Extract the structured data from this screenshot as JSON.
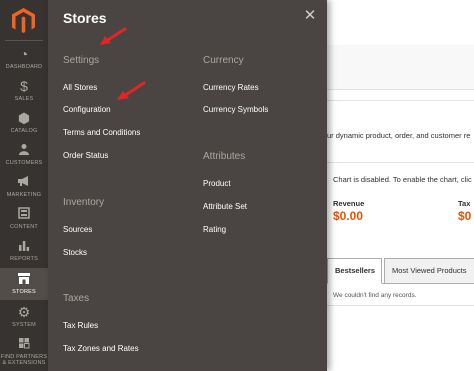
{
  "nav": {
    "items": [
      {
        "label": "DASHBOARD",
        "icon": "dashboard-icon",
        "glyph": "◔"
      },
      {
        "label": "SALES",
        "icon": "dollar-icon",
        "glyph": "$"
      },
      {
        "label": "CATALOG",
        "icon": "cube-icon",
        "glyph": "⬢"
      },
      {
        "label": "CUSTOMERS",
        "icon": "customers-icon",
        "glyph": "👤"
      },
      {
        "label": "MARKETING",
        "icon": "megaphone-icon",
        "glyph": "📢"
      },
      {
        "label": "CONTENT",
        "icon": "content-icon",
        "glyph": "▦"
      },
      {
        "label": "REPORTS",
        "icon": "reports-icon",
        "glyph": "▮"
      },
      {
        "label": "STORES",
        "icon": "store-icon",
        "glyph": "⌂"
      },
      {
        "label": "SYSTEM",
        "icon": "gear-icon",
        "glyph": "⚙"
      },
      {
        "label": "FIND PARTNERS & EXTENSIONS",
        "icon": "partners-icon",
        "glyph": "▣"
      }
    ]
  },
  "flyout": {
    "title": "Stores",
    "close_icon": "close-icon",
    "settings": {
      "title": "Settings",
      "links": [
        "All Stores",
        "Configuration",
        "Terms and Conditions",
        "Order Status"
      ]
    },
    "inventory": {
      "title": "Inventory",
      "links": [
        "Sources",
        "Stocks"
      ]
    },
    "taxes": {
      "title": "Taxes",
      "links": [
        "Tax Rules",
        "Tax Zones and Rates"
      ]
    },
    "currency": {
      "title": "Currency",
      "links": [
        "Currency Rates",
        "Currency Symbols"
      ]
    },
    "attributes": {
      "title": "Attributes",
      "links": [
        "Product",
        "Attribute Set",
        "Rating"
      ]
    }
  },
  "content": {
    "intro_text": "ur dynamic product, order, and customer re",
    "chart_disabled_text": "Chart is disabled. To enable the chart, clic",
    "revenue_label": "Revenue",
    "revenue_value": "$0.00",
    "tax_label": "Tax",
    "tax_value": "$0",
    "tabs": [
      "Bestsellers",
      "Most Viewed Products"
    ],
    "empty_text": "We couldn't find any records."
  },
  "colors": {
    "nav_bg": "#373330",
    "flyout_bg": "#4a4542",
    "accent": "#eb5202",
    "arrow": "#e22626"
  }
}
